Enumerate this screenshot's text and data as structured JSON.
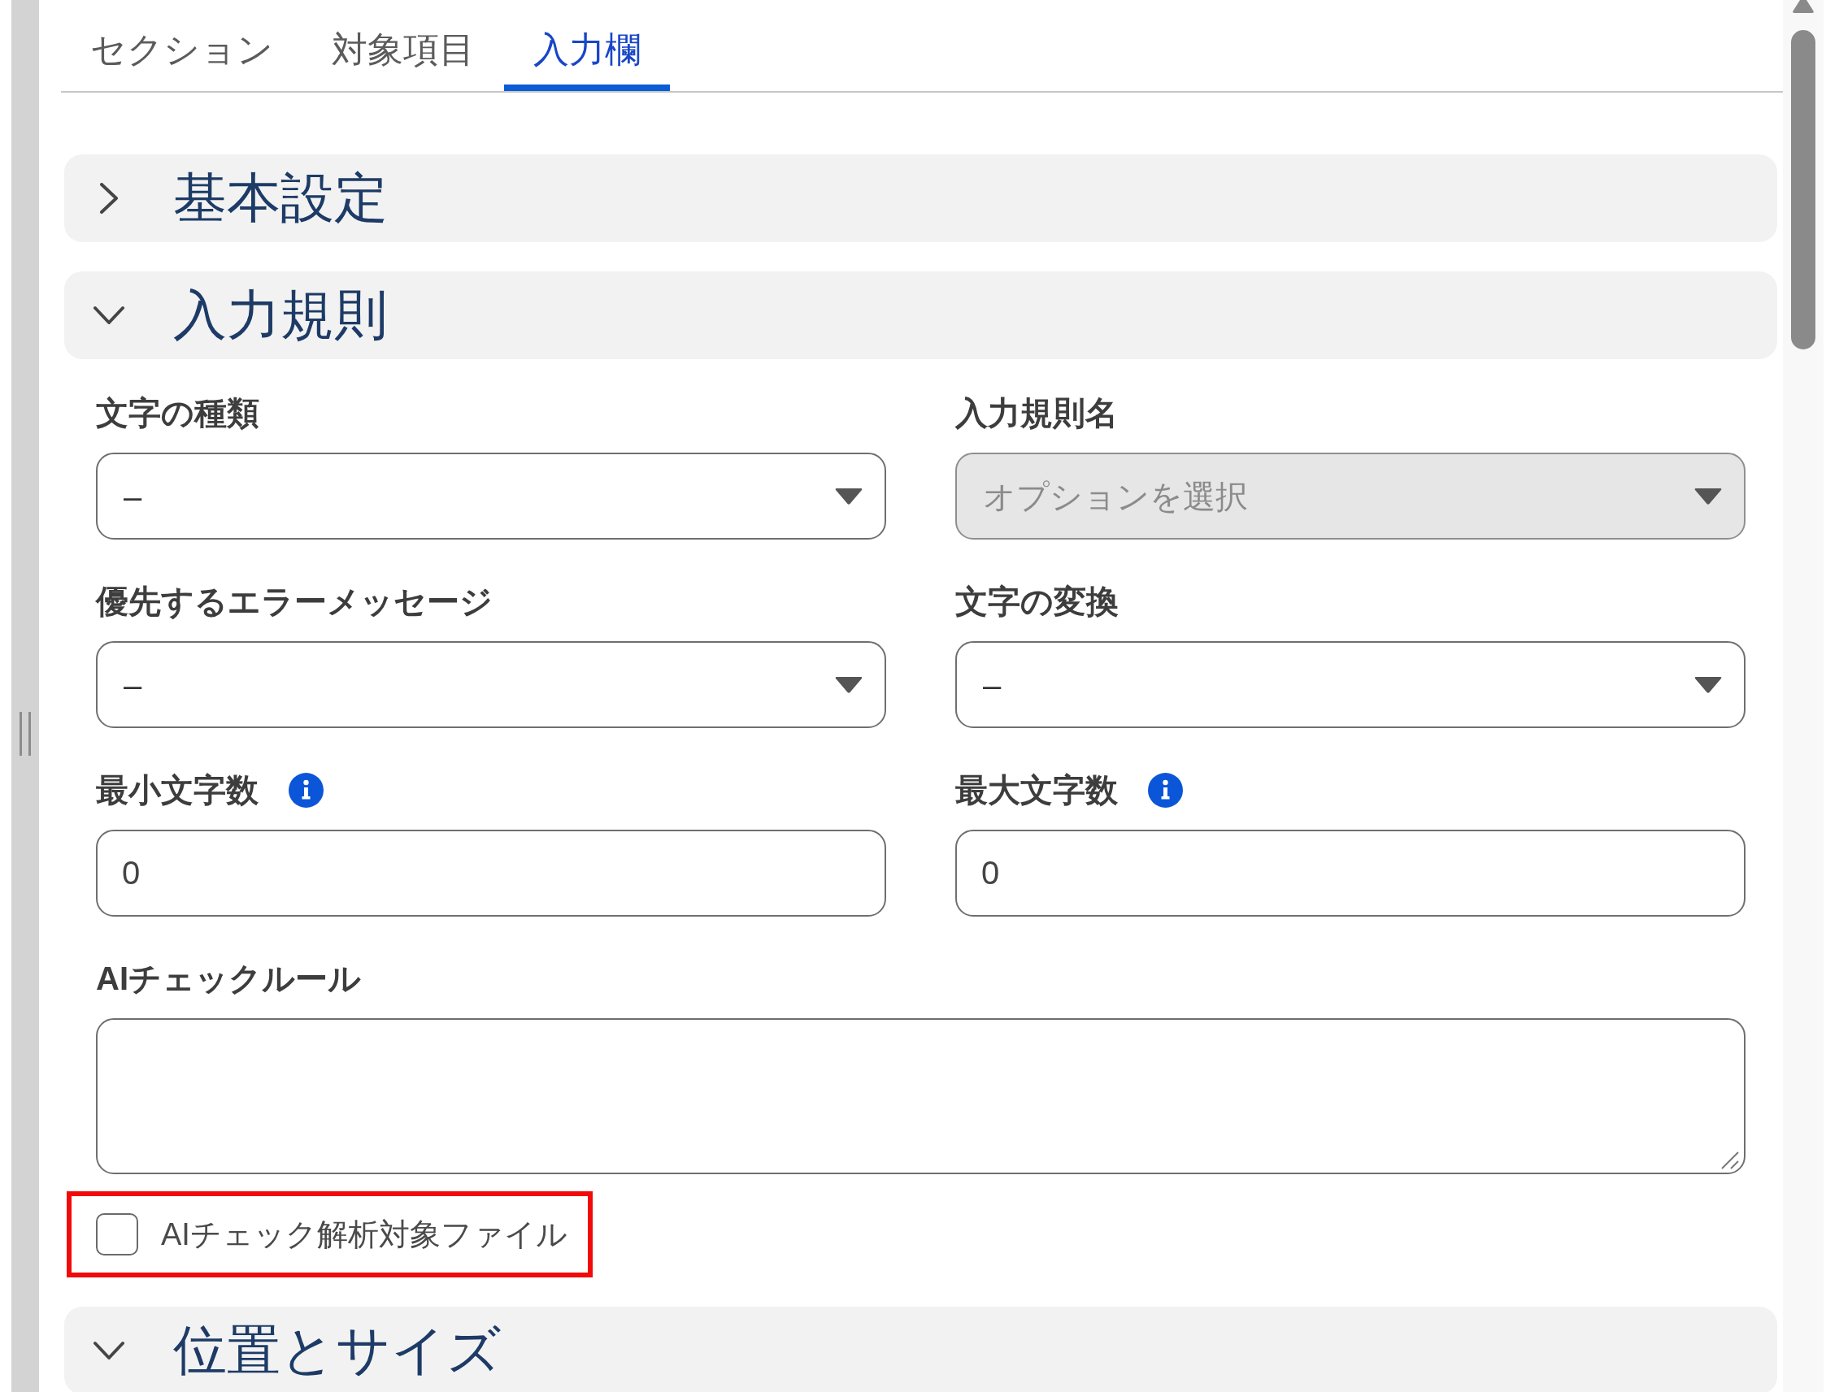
{
  "tabs": [
    {
      "label": "セクション",
      "selected": false
    },
    {
      "label": "対象項目",
      "selected": false
    },
    {
      "label": "入力欄",
      "selected": true
    }
  ],
  "sections": [
    {
      "title": "基本設定",
      "expanded": false
    },
    {
      "title": "入力規則",
      "expanded": true,
      "fields": [
        {
          "kind": "select",
          "label": "文字の種類",
          "value": "–",
          "disabled": false
        },
        {
          "kind": "select",
          "label": "入力規則名",
          "placeholder": "オプションを選択",
          "disabled": true
        },
        {
          "kind": "select",
          "label": "優先するエラーメッセージ",
          "value": "–",
          "disabled": false
        },
        {
          "kind": "select",
          "label": "文字の変換",
          "value": "–",
          "disabled": false
        },
        {
          "kind": "number",
          "label": "最小文字数",
          "value": "0",
          "info": true
        },
        {
          "kind": "number",
          "label": "最大文字数",
          "value": "0",
          "info": true
        },
        {
          "kind": "textarea",
          "label": "AIチェックルール"
        },
        {
          "kind": "checkbox",
          "label": "AIチェック解析対象ファイル",
          "checked": false,
          "highlighted": true
        }
      ]
    },
    {
      "title": "位置とサイズ",
      "expanded": true
    }
  ]
}
